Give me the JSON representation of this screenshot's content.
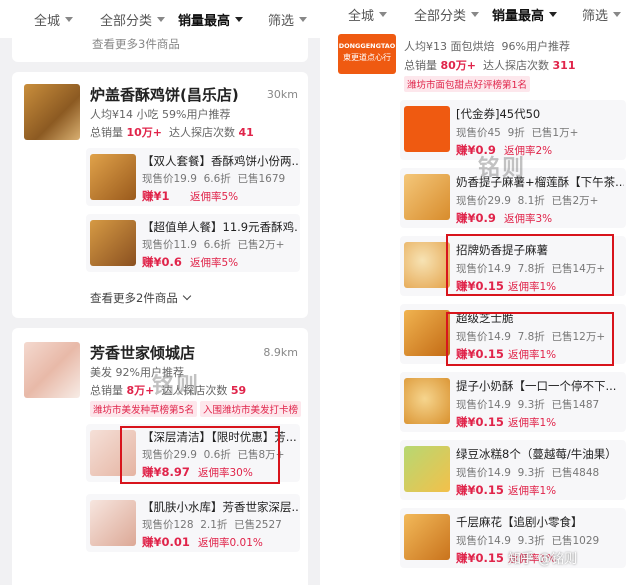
{
  "filters": {
    "city": "全城",
    "category": "全部分类",
    "sort": "销量最高",
    "filter": "筛选"
  },
  "left": {
    "top_partial": "查看更多3件商品",
    "shop1": {
      "name": "炉盖香酥鸡饼(昌乐店)",
      "distance": "30km",
      "per_capita": "人均¥14 小吃",
      "recommend": "59%用户推荐",
      "sales_label": "总销量",
      "sales_value": "10万+",
      "visits_label": "达人探店次数",
      "visits_value": "41",
      "deals": [
        {
          "title": "【双人套餐】香酥鸡饼小份两...",
          "price": "现售价19.9",
          "discount": "6.6折",
          "sold": "已售1679",
          "earn": "赚¥1",
          "rate": "返佣率5%"
        },
        {
          "title": "【超值单人餐】11.9元香酥鸡...",
          "price": "现售价11.9",
          "discount": "6.6折",
          "sold": "已售2万+",
          "earn": "赚¥0.6",
          "rate": "返佣率5%"
        }
      ],
      "more": "查看更多2件商品"
    },
    "shop2": {
      "name": "芳香世家倾城店",
      "distance": "8.9km",
      "per_capita": "美发",
      "recommend": "92%用户推荐",
      "sales_label": "总销量",
      "sales_value": "8万+",
      "visits_label": "达人探店次数",
      "visits_value": "59",
      "tags": [
        "潍坊市美发种草榜第5名",
        "入围潍坊市美发打卡榜"
      ],
      "deals": [
        {
          "title": "【深层清洁】【限时优惠】芳...",
          "price": "现售价29.9",
          "discount": "0.6折",
          "sold": "已售8万+",
          "earn": "赚¥8.97",
          "rate": "返佣率30%"
        },
        {
          "title": "【肌肤小水库】芳香世家深层...",
          "price": "现售价128",
          "discount": "2.1折",
          "sold": "已售2527",
          "earn": "赚¥0.01",
          "rate": "返佣率0.01%"
        }
      ]
    },
    "watermark": "铭则"
  },
  "right": {
    "shop": {
      "logo_text": "DONGGENGTAO",
      "logo_sub": "東更道点心行",
      "per_capita": "人均¥13 面包烘焙",
      "recommend": "96%用户推荐",
      "sales_label": "总销量",
      "sales_value": "80万+",
      "visits_label": "达人探店次数",
      "visits_value": "311",
      "tag": "潍坊市面包甜点好评榜第1名"
    },
    "deals": [
      {
        "title": "[代金券]45代50",
        "price": "现售价45",
        "discount": "9折",
        "sold": "已售1万+",
        "earn": "赚¥0.9",
        "rate": "返佣率2%"
      },
      {
        "title": "奶香提子麻薯+榴莲酥【下午茶...",
        "price": "现售价29.9",
        "discount": "8.1折",
        "sold": "已售2万+",
        "earn": "赚¥0.9",
        "rate": "返佣率3%"
      },
      {
        "title": "招牌奶香提子麻薯",
        "price": "现售价14.9",
        "discount": "7.8折",
        "sold": "已售14万+",
        "earn": "赚¥0.15",
        "rate": "返佣率1%"
      },
      {
        "title": "超级芝士脆",
        "price": "现售价14.9",
        "discount": "7.8折",
        "sold": "已售12万+",
        "earn": "赚¥0.15",
        "rate": "返佣率1%"
      },
      {
        "title": "提子小奶酥【一口一个停不下...",
        "price": "现售价14.9",
        "discount": "9.3折",
        "sold": "已售1487",
        "earn": "赚¥0.15",
        "rate": "返佣率1%"
      },
      {
        "title": "绿豆冰糕8个（蔓越莓/牛油果）",
        "price": "现售价14.9",
        "discount": "9.3折",
        "sold": "已售4848",
        "earn": "赚¥0.15",
        "rate": "返佣率1%"
      },
      {
        "title": "千层麻花【追剧小零食】",
        "price": "现售价14.9",
        "discount": "9.3折",
        "sold": "已售1029",
        "earn": "赚¥0.15",
        "rate": "返佣率1%"
      }
    ],
    "watermark": "铭则",
    "footer_watermark": "知乎 @铭则"
  },
  "colors": {
    "accent_red": "#e0244a",
    "highlight_box": "#d8141c",
    "brand_orange": "#ef5a11"
  }
}
